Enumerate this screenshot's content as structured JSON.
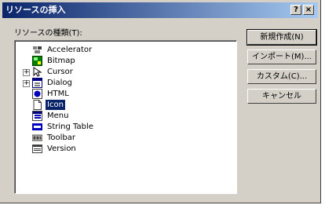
{
  "window": {
    "title": "リソースの挿入",
    "help_label": "?",
    "close_label": "×"
  },
  "tree": {
    "label": "リソースの種類(T):",
    "items": [
      {
        "label": "Accelerator",
        "icon": "accelerator-icon",
        "expandable": false,
        "selected": false
      },
      {
        "label": "Bitmap",
        "icon": "bitmap-icon",
        "expandable": false,
        "selected": false
      },
      {
        "label": "Cursor",
        "icon": "cursor-icon",
        "expandable": true,
        "selected": false
      },
      {
        "label": "Dialog",
        "icon": "dialog-icon",
        "expandable": true,
        "selected": false
      },
      {
        "label": "HTML",
        "icon": "html-icon",
        "expandable": false,
        "selected": false
      },
      {
        "label": "Icon",
        "icon": "icon-resource-icon",
        "expandable": false,
        "selected": true
      },
      {
        "label": "Menu",
        "icon": "menu-icon",
        "expandable": false,
        "selected": false
      },
      {
        "label": "String Table",
        "icon": "string-table-icon",
        "expandable": false,
        "selected": false
      },
      {
        "label": "Toolbar",
        "icon": "toolbar-icon",
        "expandable": false,
        "selected": false
      },
      {
        "label": "Version",
        "icon": "version-icon",
        "expandable": false,
        "selected": false
      }
    ],
    "expander_symbol": "+"
  },
  "buttons": {
    "new": "新規作成(N)",
    "import": "インポート(M)...",
    "custom": "カスタム(C)...",
    "cancel": "キャンセル"
  },
  "colors": {
    "titlebar_start": "#0a246a",
    "titlebar_end": "#a6caf0",
    "face": "#d4d0c8",
    "selection": "#0a246a"
  }
}
